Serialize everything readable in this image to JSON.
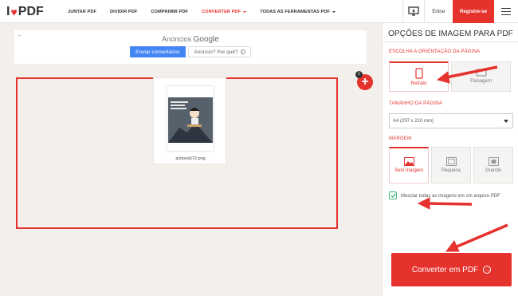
{
  "brand": {
    "logo_left": "I",
    "logo_heart": "♥",
    "logo_right": "PDF"
  },
  "nav": {
    "items": [
      {
        "label": "JUNTAR PDF"
      },
      {
        "label": "DIVIDIR PDF"
      },
      {
        "label": "COMPRIMIR PDF"
      },
      {
        "label": "CONVERTER PDF"
      },
      {
        "label": "TODAS AS FERRAMENTAS PDF"
      }
    ],
    "login": "Entrar",
    "register": "Registre-se"
  },
  "ads": {
    "back": "←",
    "title_prefix": "Anúncios",
    "title_brand": "Google",
    "feedback_button": "Enviar comentários",
    "why_button": "Anúncio? Por quê?",
    "info_glyph": "i"
  },
  "workspace": {
    "file_name": "actions672.png",
    "file_count": "1",
    "add_glyph": "+"
  },
  "panel": {
    "title": "OPÇÕES DE IMAGEM PARA PDF",
    "orientation_label": "ESCOLHA A ORIENTAÇÃO DA PÁGINA",
    "orientation_options": [
      "Retrato",
      "Paisagem"
    ],
    "page_size_label": "TAMANHO DA PÁGINA",
    "page_size_value": "A4 (297 x 210 mm)",
    "margin_label": "MARGEM",
    "margin_options": [
      "Sem margem",
      "Pequena",
      "Grande"
    ],
    "merge_label": "Mesclar todas as imagens em um arquivo PDF",
    "convert_button": "Converter em PDF",
    "convert_glyph": "→"
  },
  "colors": {
    "accent": "#e5322d",
    "check": "#3fb57b",
    "ad_blue": "#4285f4"
  }
}
